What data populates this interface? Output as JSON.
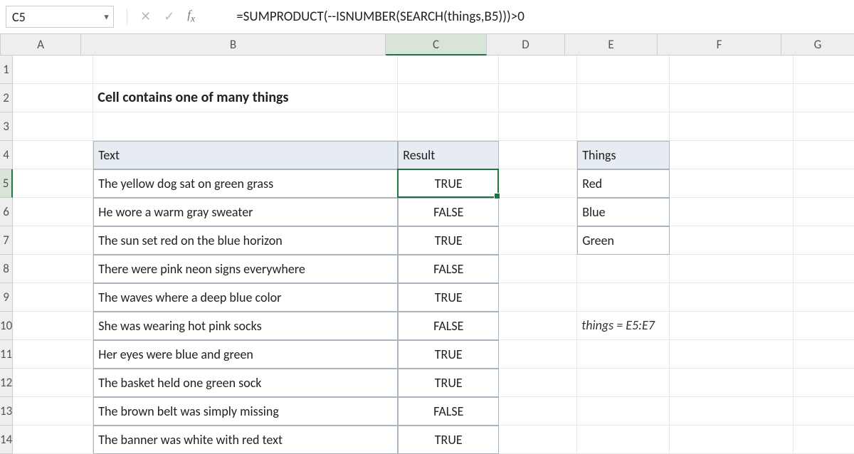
{
  "name_box": "C5",
  "formula": "=SUMPRODUCT(--ISNUMBER(SEARCH(things,B5)))>0",
  "columns": [
    "A",
    "B",
    "C",
    "D",
    "E",
    "F",
    "G"
  ],
  "active_col": "C",
  "rows": [
    "1",
    "2",
    "3",
    "4",
    "5",
    "6",
    "7",
    "8",
    "9",
    "10",
    "11",
    "12",
    "13",
    "14"
  ],
  "active_row": "5",
  "title": "Cell contains one of many things",
  "headers": {
    "text": "Text",
    "result": "Result",
    "things": "Things"
  },
  "data_rows": [
    {
      "text": "The yellow dog sat on green grass",
      "result": "TRUE"
    },
    {
      "text": "He wore a warm gray sweater",
      "result": "FALSE"
    },
    {
      "text": "The sun set red on the blue horizon",
      "result": "TRUE"
    },
    {
      "text": "There were pink neon signs everywhere",
      "result": "FALSE"
    },
    {
      "text": "The waves where a deep blue color",
      "result": "TRUE"
    },
    {
      "text": "She was wearing hot pink socks",
      "result": "FALSE"
    },
    {
      "text": "Her eyes were blue and green",
      "result": "TRUE"
    },
    {
      "text": "The basket held one green sock",
      "result": "TRUE"
    },
    {
      "text": "The brown belt was simply missing",
      "result": "FALSE"
    },
    {
      "text": "The banner was white with red text",
      "result": "TRUE"
    }
  ],
  "things": [
    "Red",
    "Blue",
    "Green"
  ],
  "note": "things = E5:E7"
}
